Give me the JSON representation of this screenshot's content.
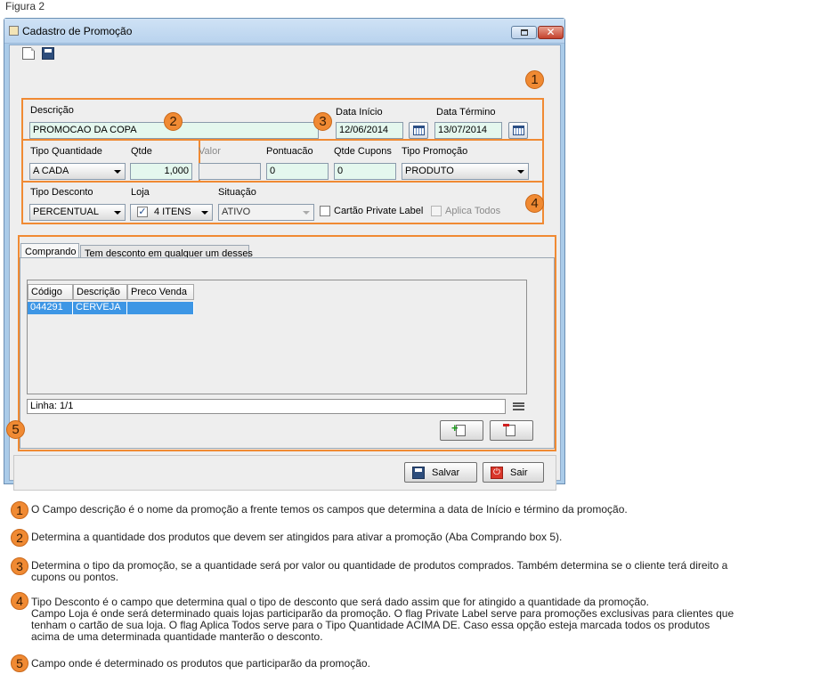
{
  "figure_label": "Figura 2",
  "window": {
    "title": "Cadastro de Promoção",
    "close_glyph": "✕"
  },
  "toolbar": {
    "icons": [
      "new-document-icon",
      "save-disk-icon"
    ]
  },
  "form": {
    "descricao_label": "Descrição",
    "descricao_value": "PROMOCAO DA COPA",
    "data_inicio_label": "Data Início",
    "data_inicio_value": "12/06/2014",
    "data_termino_label": "Data Término",
    "data_termino_value": "13/07/2014",
    "tipo_quantidade_label": "Tipo Quantidade",
    "tipo_quantidade_value": "A CADA",
    "qtde_label": "Qtde",
    "qtde_value": "1,000",
    "valor_label": "Valor",
    "valor_value": "",
    "pontuacao_label": "Pontuacão",
    "pontuacao_value": "0",
    "qtde_cupons_label": "Qtde Cupons",
    "qtde_cupons_value": "0",
    "tipo_promocao_label": "Tipo Promoção",
    "tipo_promocao_value": "PRODUTO",
    "tipo_desconto_label": "Tipo Desconto",
    "tipo_desconto_value": "PERCENTUAL",
    "loja_label": "Loja",
    "loja_value": "4 ITENS",
    "loja_checked": "✓",
    "situacao_label": "Situação",
    "situacao_value": "ATIVO",
    "private_label_label": "Cartão Private Label",
    "aplica_todos_label": "Aplica Todos"
  },
  "badges": {
    "b1": "1",
    "b2": "2",
    "b3": "3",
    "b4": "4",
    "b5": "5"
  },
  "tabs": [
    {
      "label": "Comprando"
    },
    {
      "label": "Tem desconto em qualquer um desses"
    }
  ],
  "grid": {
    "columns": [
      "Código",
      "Descrição",
      "Preco Venda"
    ],
    "rows": [
      [
        "044291",
        "CERVEJA",
        ""
      ]
    ]
  },
  "status_text": "Linha: 1/1",
  "buttons": {
    "salvar": "Salvar",
    "sair": "Sair",
    "sair_glyph": "⏻"
  },
  "notes": [
    {
      "num": "1",
      "lines": [
        "O Campo descrição é o nome da promoção a frente temos os campos que determina a data de Início e término da promoção."
      ]
    },
    {
      "num": "2",
      "lines": [
        "Determina a quantidade dos produtos que devem ser atingidos para ativar a promoção (Aba Comprando box 5)."
      ]
    },
    {
      "num": "3",
      "lines": [
        "Determina o tipo da promoção, se a quantidade será por valor ou quantidade de produtos comprados. Também determina se o cliente terá direito a",
        "cupons ou pontos."
      ]
    },
    {
      "num": "4",
      "lines": [
        "Tipo Desconto é o campo que determina qual o tipo de desconto que será dado assim que for atingido a quantidade da promoção.",
        "Campo Loja é onde será determinado quais lojas participarão da promoção. O flag Private Label serve para promoções exclusivas para clientes que",
        "tenham o cartão de sua loja. O flag Aplica Todos serve para o Tipo Quantidade ACIMA DE. Caso essa opção esteja marcada todos os produtos",
        "acima de uma determinada quantidade manterão o desconto."
      ]
    },
    {
      "num": "5",
      "lines": [
        "Campo onde é determinado os produtos que participarão da promoção."
      ]
    }
  ]
}
